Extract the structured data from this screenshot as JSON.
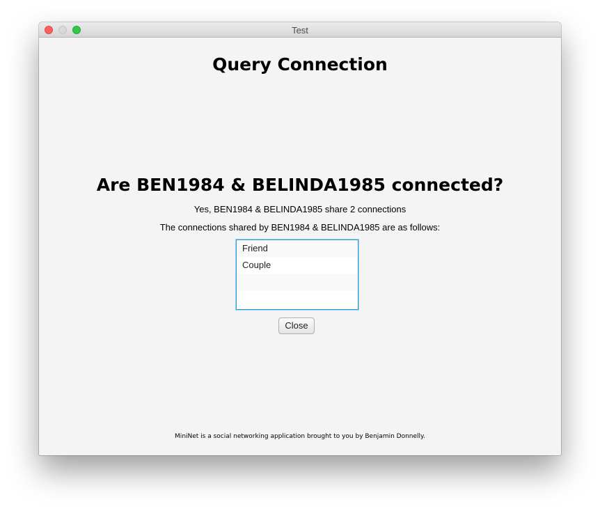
{
  "window": {
    "title": "Test"
  },
  "page": {
    "title": "Query Connection",
    "question": "Are BEN1984 & BELINDA1985 connected?",
    "answer": "Yes, BEN1984 & BELINDA1985 share 2 connections",
    "shared_label": "The connections shared by BEN1984 & BELINDA1985 are as follows:"
  },
  "connections": {
    "items": [
      {
        "label": "Friend"
      },
      {
        "label": "Couple"
      },
      {
        "label": ""
      },
      {
        "label": ""
      }
    ]
  },
  "actions": {
    "close_label": "Close"
  },
  "footer": {
    "text": "MiniNet is a social networking application brought to you by Benjamin Donnelly."
  },
  "colors": {
    "focus_border": "#2f9ad8",
    "traffic_close": "#fc605c",
    "traffic_minimize": "#d9d9d9",
    "traffic_maximize": "#34c84a"
  }
}
